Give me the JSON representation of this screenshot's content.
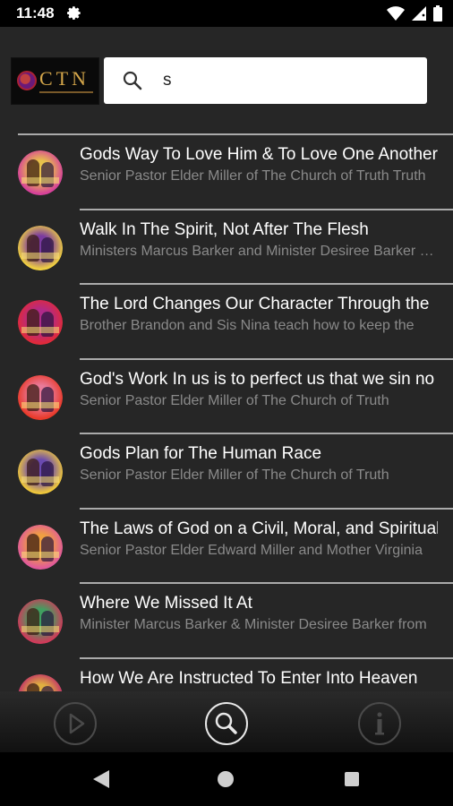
{
  "status_bar": {
    "time": "11:48",
    "icons": [
      "gear-icon",
      "wifi-icon",
      "signal-icon",
      "battery-icon"
    ]
  },
  "header": {
    "logo_text": "CTN",
    "search": {
      "value": "s",
      "icon": "search-icon"
    }
  },
  "results": [
    {
      "title": "Gods Way To Love Him & To Love One Another",
      "subtitle": "Senior Pastor Elder Miller of The Church of Truth Truth",
      "thumb_colors": [
        "#d6409a",
        "#e8c14b"
      ]
    },
    {
      "title": "Walk In The Spirit, Not After The Flesh",
      "subtitle": "Ministers Marcus Barker and Minister Desiree Barker share",
      "thumb_colors": [
        "#f0d040",
        "#7a3aa0"
      ]
    },
    {
      "title": "The Lord Changes Our Character Through the",
      "subtitle": "Brother Brandon and Sis Nina teach how to keep the",
      "thumb_colors": [
        "#e02a3a",
        "#b02a8a"
      ]
    },
    {
      "title": "God's Work In us is to perfect us that we sin no",
      "subtitle": "Senior Pastor Elder Miller of The Church of Truth",
      "thumb_colors": [
        "#e83a2a",
        "#e87a9a"
      ]
    },
    {
      "title": "Gods Plan for The Human Race",
      "subtitle": "Senior Pastor Elder Miller of The Church of Truth",
      "thumb_colors": [
        "#f0c83a",
        "#6a4ab0"
      ]
    },
    {
      "title": "The Laws of God on a Civil, Moral, and Spiritual",
      "subtitle": "Senior Pastor Elder Edward Miller and Mother Virginia",
      "thumb_colors": [
        "#e05a9a",
        "#f0a040"
      ]
    },
    {
      "title": "Where We Missed It At",
      "subtitle": "Minister Marcus Barker & Minister Desiree Barker from",
      "thumb_colors": [
        "#d03a5a",
        "#40a060"
      ]
    },
    {
      "title": "How We Are Instructed To Enter Into Heaven",
      "subtitle": "",
      "thumb_colors": [
        "#c02a6a",
        "#e0b040"
      ]
    }
  ],
  "bottom_nav": {
    "items": [
      "play-icon",
      "search-icon",
      "info-icon"
    ],
    "active": "search-icon"
  },
  "system_nav": [
    "back-icon",
    "home-icon",
    "recents-icon"
  ],
  "colors": {
    "background": "#262626",
    "title_text": "#ffffff",
    "subtitle_text": "#8a8a8a",
    "divider": "#aaaaaa",
    "logo_gold": "#d4a64a"
  }
}
